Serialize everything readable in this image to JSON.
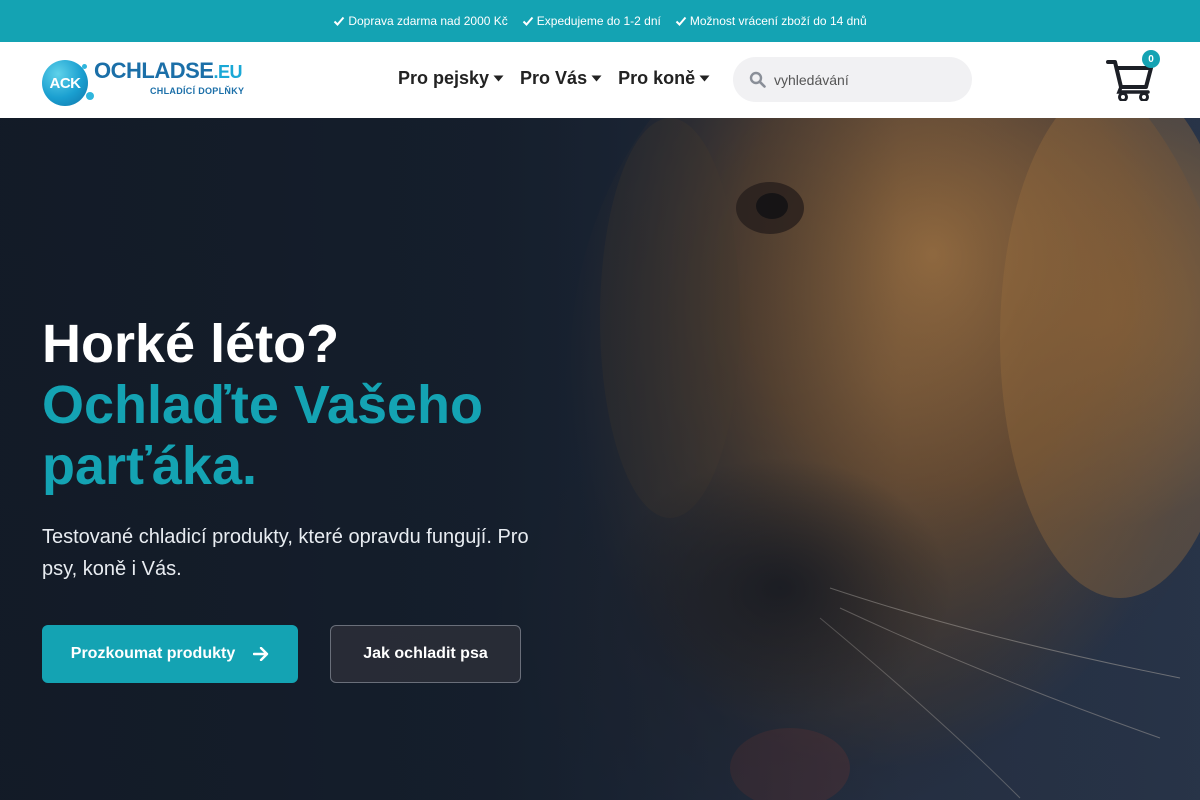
{
  "topbar": {
    "benefits": [
      "Doprava zdarma nad 2000 Kč",
      "Expedujeme do 1-2 dní",
      "Možnost vrácení zboží do 14 dnů"
    ]
  },
  "header": {
    "logo": {
      "ack": "ACK",
      "brand": "OCHLADSE",
      "tld": ".EU",
      "tagline": "CHLADÍCÍ DOPLŇKY"
    },
    "nav": [
      "Pro pejsky",
      "Pro Vás",
      "Pro koně"
    ],
    "search": {
      "placeholder": "vyhledávání",
      "value": ""
    },
    "cart": {
      "count": "0"
    }
  },
  "hero": {
    "title_line1": "Horké léto?",
    "title_accent": "Ochlaďte Vašeho parťáka.",
    "subtitle": "Testované chladicí produkty, které opravdu fungují. Pro psy, koně i Vás.",
    "primary_button": "Prozkoumat produkty",
    "secondary_button": "Jak ochladit psa"
  },
  "colors": {
    "accent": "#14a3b3",
    "topbar_bg": "#14a3b3",
    "hero_text": "#ffffff"
  }
}
